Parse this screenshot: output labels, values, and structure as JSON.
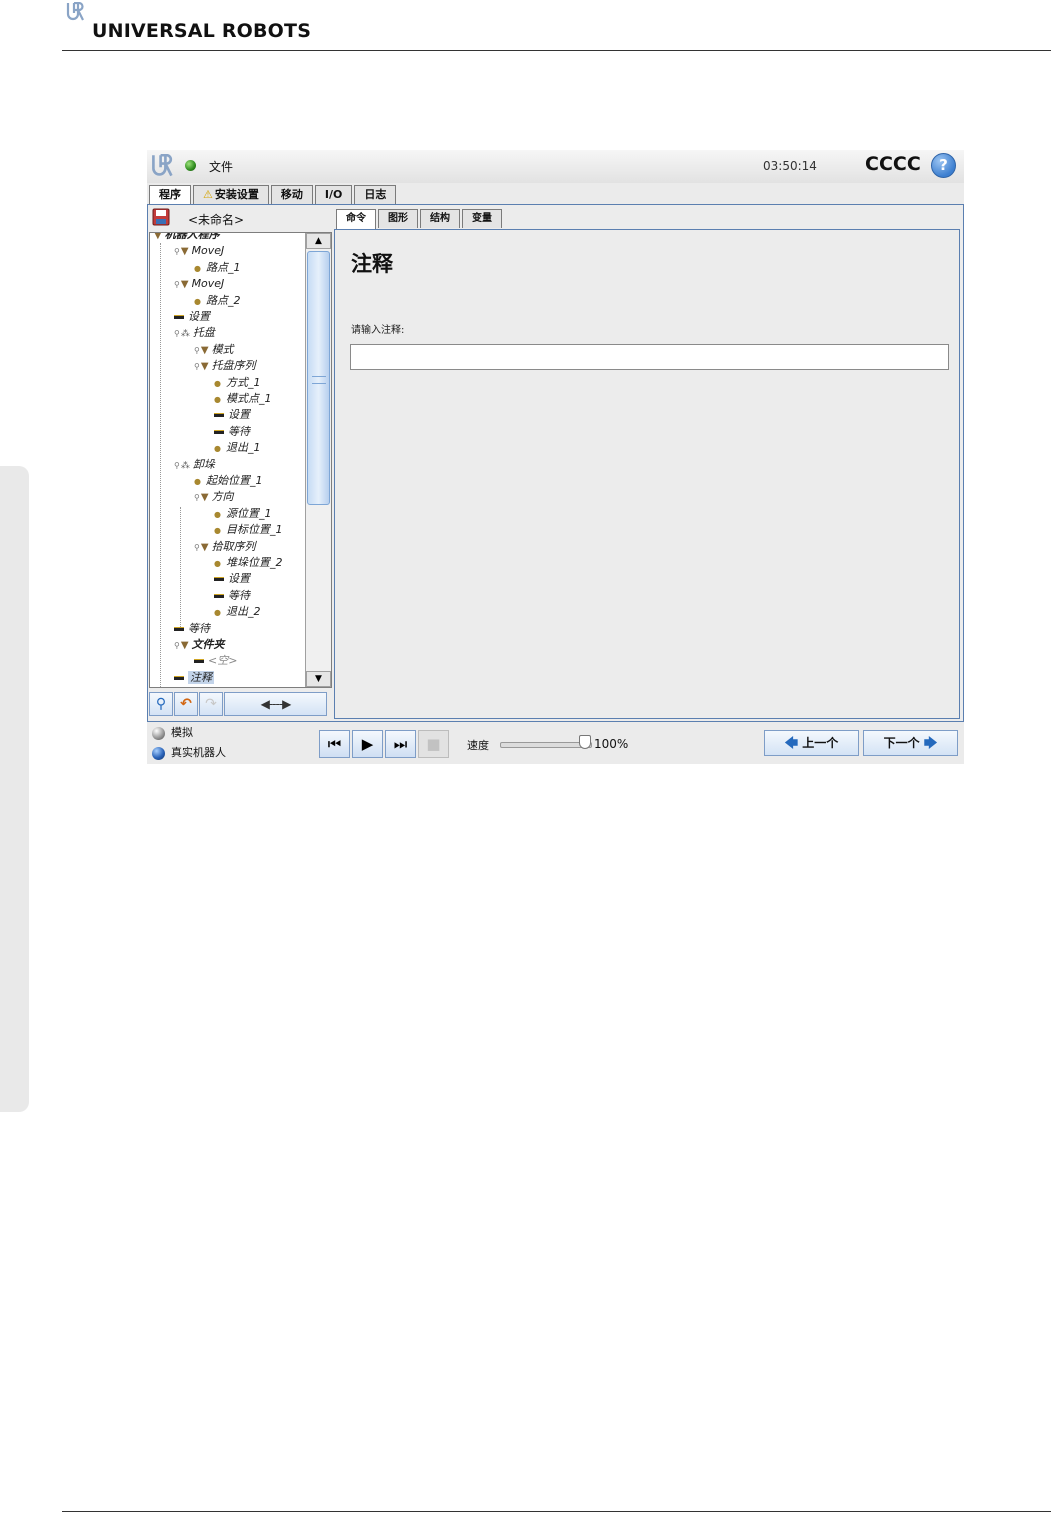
{
  "brand": {
    "name": "UNIVERSAL ROBOTS",
    "logo_icon": "ur-logo-icon"
  },
  "titlebar": {
    "file_menu": "文件",
    "time": "03:50:14",
    "robot_name": "CCCC",
    "help": "?"
  },
  "main_tabs": [
    {
      "label": "程序",
      "active": true
    },
    {
      "label": "安装设置",
      "warning": true
    },
    {
      "label": "移动"
    },
    {
      "label": "I/O"
    },
    {
      "label": "日志"
    }
  ],
  "program": {
    "name": "<未命名>",
    "tree": [
      {
        "label": "机器人程序",
        "level": 0,
        "icon": "triangle",
        "bold": true
      },
      {
        "label": "MoveJ",
        "level": 1,
        "icon": "triangle"
      },
      {
        "label": "路点_1",
        "level": 2,
        "icon": "dot"
      },
      {
        "label": "MoveJ",
        "level": 1,
        "icon": "triangle"
      },
      {
        "label": "路点_2",
        "level": 2,
        "icon": "dot"
      },
      {
        "label": "设置",
        "level": 1,
        "icon": "bar"
      },
      {
        "label": "托盘",
        "level": 1,
        "icon": "group"
      },
      {
        "label": "模式",
        "level": 2,
        "icon": "triangle"
      },
      {
        "label": "托盘序列",
        "level": 2,
        "icon": "triangle"
      },
      {
        "label": "方式_1",
        "level": 3,
        "icon": "dot"
      },
      {
        "label": "模式点_1",
        "level": 3,
        "icon": "dot"
      },
      {
        "label": "设置",
        "level": 3,
        "icon": "bar"
      },
      {
        "label": "等待",
        "level": 3,
        "icon": "bar"
      },
      {
        "label": "退出_1",
        "level": 3,
        "icon": "dot"
      },
      {
        "label": "卸垛",
        "level": 1,
        "icon": "group"
      },
      {
        "label": "起始位置_1",
        "level": 2,
        "icon": "dot"
      },
      {
        "label": "方向",
        "level": 2,
        "icon": "triangle"
      },
      {
        "label": "源位置_1",
        "level": 3,
        "icon": "dot"
      },
      {
        "label": "目标位置_1",
        "level": 3,
        "icon": "dot"
      },
      {
        "label": "拾取序列",
        "level": 2,
        "icon": "triangle"
      },
      {
        "label": "堆垛位置_2",
        "level": 3,
        "icon": "dot"
      },
      {
        "label": "设置",
        "level": 3,
        "icon": "bar"
      },
      {
        "label": "等待",
        "level": 3,
        "icon": "bar"
      },
      {
        "label": "退出_2",
        "level": 3,
        "icon": "dot"
      },
      {
        "label": "等待",
        "level": 1,
        "icon": "bar"
      },
      {
        "label": "文件夹",
        "level": 1,
        "icon": "triangle",
        "bold": true
      },
      {
        "label": "<空>",
        "level": 2,
        "icon": "bar",
        "gray": true
      },
      {
        "label": "注释",
        "level": 1,
        "icon": "bar",
        "selected": true
      }
    ],
    "tools": {
      "move_label": "◀----▶"
    }
  },
  "sub_tabs": [
    {
      "label": "命令",
      "active": true
    },
    {
      "label": "图形"
    },
    {
      "label": "结构"
    },
    {
      "label": "变量"
    }
  ],
  "command": {
    "title": "注释",
    "label": "请输入注释:",
    "value": ""
  },
  "bottom": {
    "modes": [
      {
        "label": "模拟",
        "icon": "simulation-ball-icon"
      },
      {
        "label": "真实机器人",
        "icon": "real-robot-ball-icon"
      }
    ],
    "speed_label": "速度",
    "speed_value": "100%",
    "speed_fraction": 1.0,
    "prev_label": "上一个",
    "next_label": "下一个"
  }
}
